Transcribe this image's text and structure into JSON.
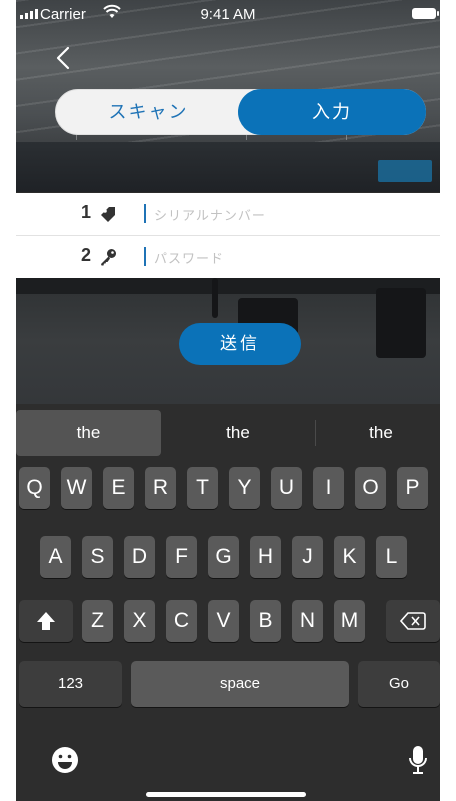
{
  "status_bar": {
    "carrier": "Carrier",
    "time": "9:41 AM"
  },
  "nav": {
    "back_icon": "chevron-left-icon"
  },
  "segmented": {
    "scan_label": "スキャン",
    "input_label": "入力",
    "selected": "入力"
  },
  "fields": [
    {
      "number": "1",
      "icon": "tag-icon",
      "placeholder": "シリアルナンバー"
    },
    {
      "number": "2",
      "icon": "key-icon",
      "placeholder": "パスワード"
    }
  ],
  "send_label": "送信",
  "keyboard": {
    "suggestions": [
      "the",
      "the",
      "the"
    ],
    "row1": [
      "Q",
      "W",
      "E",
      "R",
      "T",
      "Y",
      "U",
      "I",
      "O",
      "P"
    ],
    "row2": [
      "A",
      "S",
      "D",
      "F",
      "G",
      "H",
      "J",
      "K",
      "L"
    ],
    "row3": [
      "Z",
      "X",
      "C",
      "V",
      "B",
      "N",
      "M"
    ],
    "numbers_label": "123",
    "space_label": "space",
    "go_label": "Go",
    "icons": [
      "shift-icon",
      "backspace-icon",
      "emoji-icon",
      "microphone-icon"
    ]
  },
  "colors": {
    "accent": "#0b72b8",
    "keyboard_bg": "#2d2d2d",
    "key_bg": "#5a5a5a"
  }
}
